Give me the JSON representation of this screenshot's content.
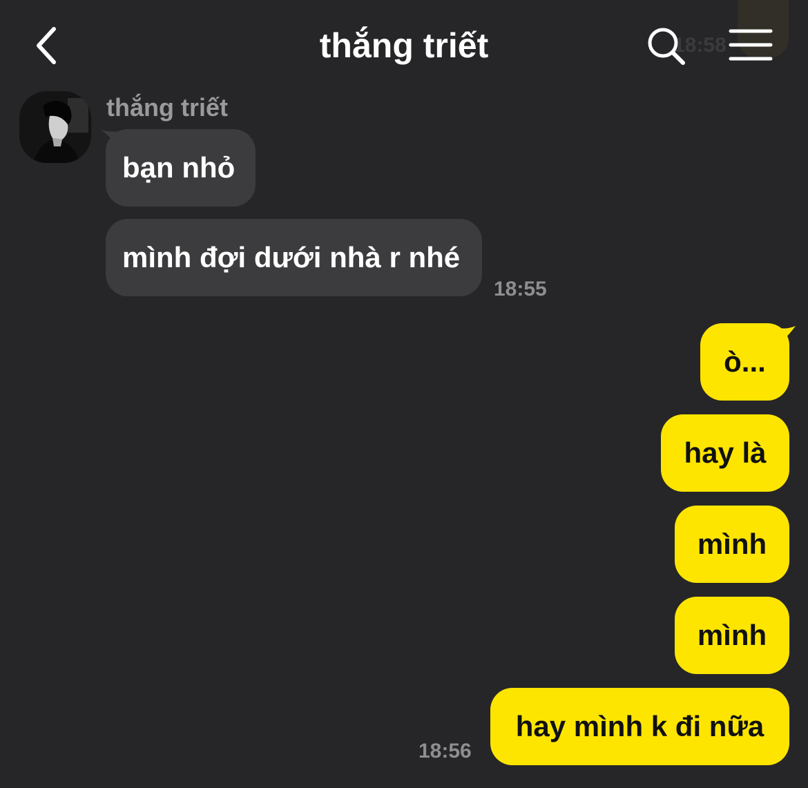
{
  "header": {
    "title": "thắng triết",
    "peek_time": "18:58"
  },
  "colors": {
    "background": "#262628",
    "incoming_bubble": "#3c3c3e",
    "outgoing_bubble": "#fee500",
    "timestamp": "#8e8e91"
  },
  "icons": {
    "back": "chevron-left-icon",
    "search": "search-icon",
    "menu": "hamburger-menu-icon"
  },
  "incoming": {
    "sender": "thắng triết",
    "messages": [
      "bạn nhỏ",
      "mình đợi dưới nhà r nhé"
    ],
    "time": "18:55"
  },
  "outgoing": {
    "messages": [
      "ò...",
      "hay là",
      "mình",
      "mình",
      "hay mình k đi nữa"
    ],
    "time": "18:56"
  }
}
